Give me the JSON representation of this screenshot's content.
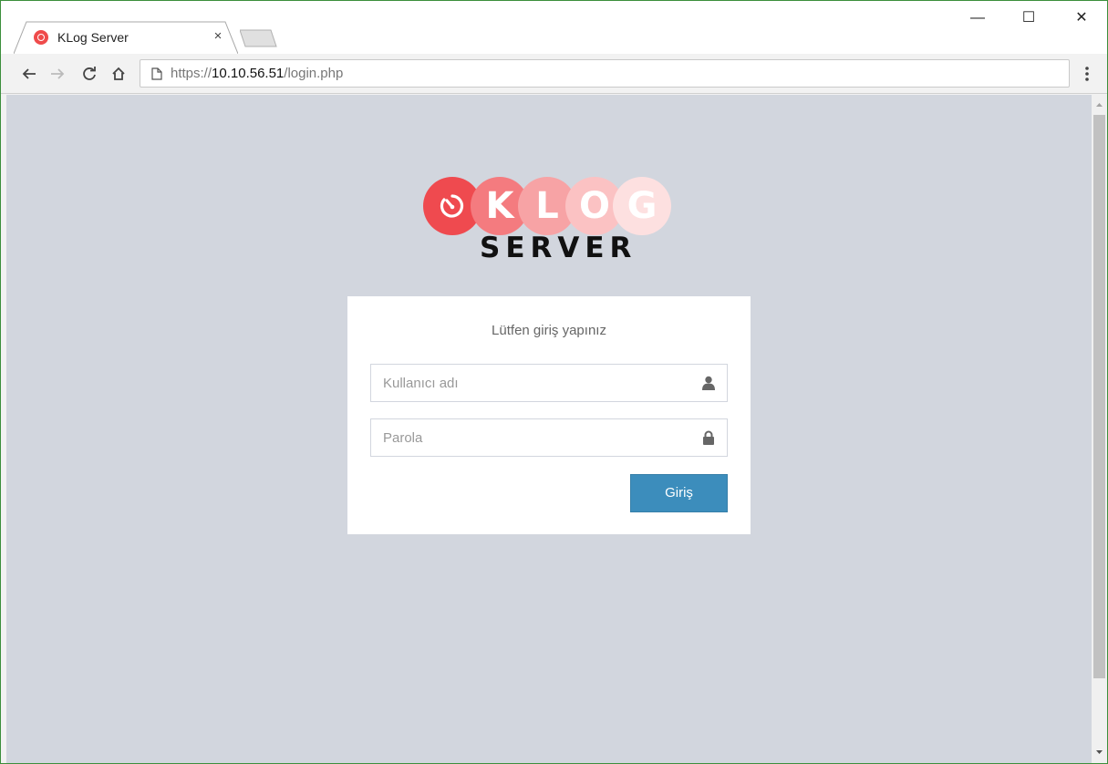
{
  "browser": {
    "tab": {
      "title": "KLog Server",
      "close_glyph": "×",
      "favicon": "klog-favicon-icon"
    },
    "window_controls": {
      "minimize": "—",
      "maximize": "☐",
      "close": "✕"
    },
    "address": {
      "scheme": "https://",
      "host": "10.10.56.51",
      "path": "/login.php"
    },
    "menu_glyph": "⋮"
  },
  "logo": {
    "letters": [
      "K",
      "L",
      "O",
      "G"
    ],
    "circle_colors": [
      "#ef4a4f",
      "#f47b7f",
      "#f7a3a5",
      "#fbc2c3",
      "#fde0e0"
    ],
    "subtitle": "SERVER"
  },
  "login": {
    "message": "Lütfen giriş yapınız",
    "username_placeholder": "Kullanıcı adı",
    "username_value": "",
    "password_placeholder": "Parola",
    "password_value": "",
    "submit_label": "Giriş"
  },
  "colors": {
    "page_bg": "#d2d6de",
    "button_bg": "#3c8dbc",
    "logo_accent": "#ef4a4f"
  }
}
